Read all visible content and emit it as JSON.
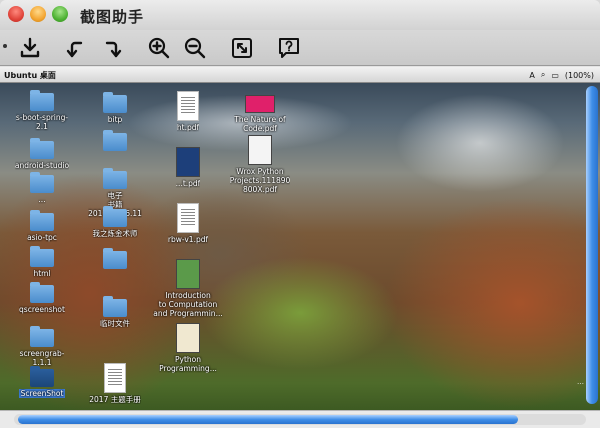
{
  "window": {
    "title": "截图助手"
  },
  "toolbar": {
    "buttons": [
      {
        "name": "save-button",
        "icon": "download-icon"
      },
      {
        "name": "undo-button",
        "icon": "undo-icon"
      },
      {
        "name": "redo-button",
        "icon": "redo-icon"
      },
      {
        "name": "zoom-in-button",
        "icon": "zoom-in-icon"
      },
      {
        "name": "zoom-out-button",
        "icon": "zoom-out-icon"
      },
      {
        "name": "fit-button",
        "icon": "fit-screen-icon"
      },
      {
        "name": "help-button",
        "icon": "help-icon"
      }
    ]
  },
  "screenshot": {
    "menubar": {
      "left": "Ubuntu 桌面",
      "battery": "(100%)"
    },
    "icons": [
      {
        "label": "s-boot-spring-\n2.1",
        "type": "folder"
      },
      {
        "label": "bitp",
        "type": "folder"
      },
      {
        "label": "ht.pdf",
        "type": "doc"
      },
      {
        "label": "The Nature of\nCode.pdf",
        "type": "pinkbook"
      },
      {
        "label": "android-studio",
        "type": "folder"
      },
      {
        "label": "",
        "type": "folder"
      },
      {
        "label": "...t.pdf",
        "type": "book"
      },
      {
        "label": "Wrox Python\nProjects.111890\n800X.pdf",
        "type": "pythonbook"
      },
      {
        "label": "...",
        "type": "folder"
      },
      {
        "label": "电子\n书籍\n2017_2016.11",
        "type": "folder"
      },
      {
        "label": "asio-tpc",
        "type": "folder"
      },
      {
        "label": "我之炼金术师",
        "type": "folder"
      },
      {
        "label": "rbw-v1.pdf",
        "type": "doc"
      },
      {
        "label": "html",
        "type": "folder"
      },
      {
        "label": "",
        "type": "folder"
      },
      {
        "label": "Introduction\nto Computation\nand Programmin...",
        "type": "greenbook"
      },
      {
        "label": "qscreenshot",
        "type": "folder"
      },
      {
        "label": "临时文件",
        "type": "folder"
      },
      {
        "label": "screengrab-\n1.1.1",
        "type": "folder"
      },
      {
        "label": "Python\nProgramming...",
        "type": "pythonbook2"
      },
      {
        "label": "ScreenShot",
        "type": "darkfolder"
      },
      {
        "label": "2017 主题手册",
        "type": "doc"
      }
    ],
    "corner_text": "…"
  },
  "colors": {
    "accent": "#3f8ee8",
    "title_text": "#222222"
  }
}
